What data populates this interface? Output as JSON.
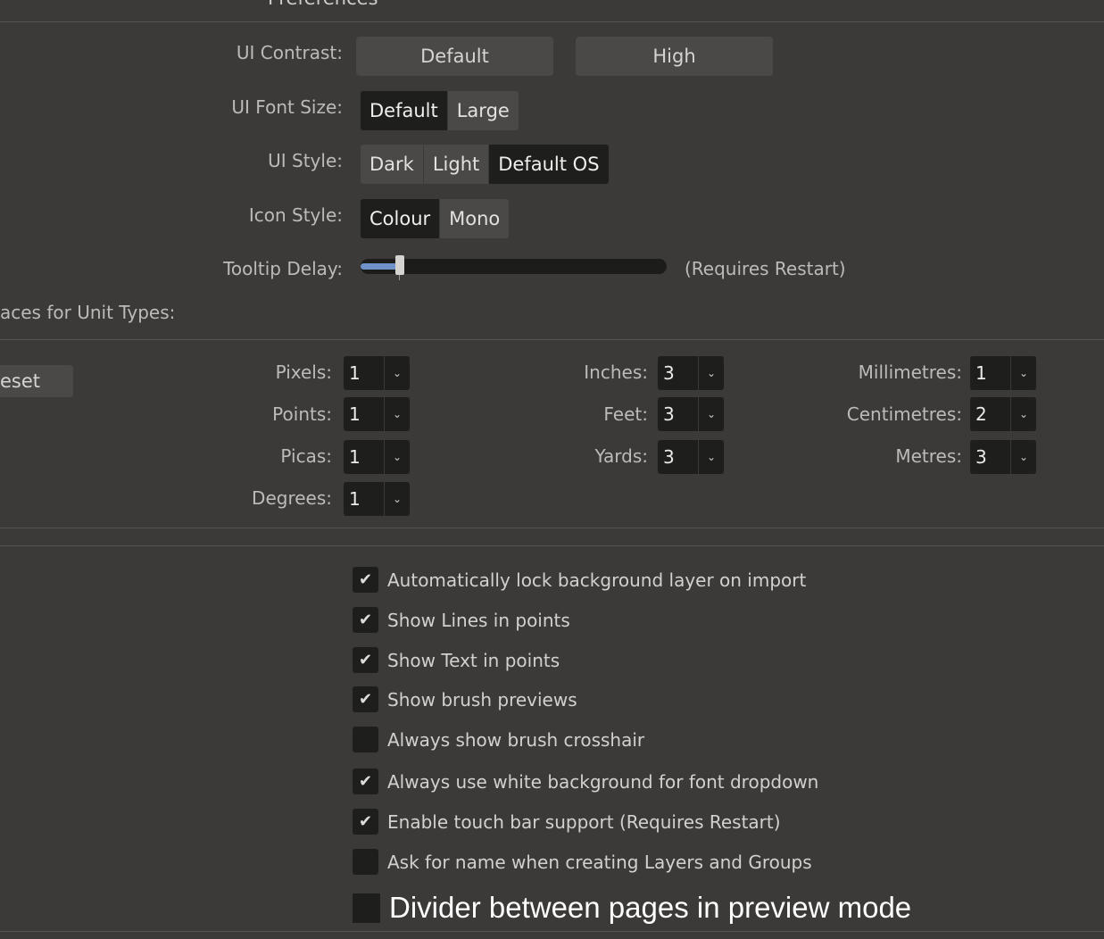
{
  "window": {
    "title": "Preferences"
  },
  "ui_contrast": {
    "label": "UI Contrast:",
    "buttons": [
      "Default",
      "High"
    ]
  },
  "ui_font_size": {
    "label": "UI Font Size:",
    "options": [
      "Default",
      "Large"
    ],
    "selected": "Default"
  },
  "ui_style": {
    "label": "UI Style:",
    "options": [
      "Dark",
      "Light",
      "Default OS"
    ],
    "selected": "Default OS"
  },
  "icon_style": {
    "label": "Icon Style:",
    "options": [
      "Colour",
      "Mono"
    ],
    "selected": "Colour"
  },
  "tooltip_delay": {
    "label": "Tooltip Delay:",
    "note": "(Requires Restart)",
    "level_fraction": 0.12
  },
  "decimal_places": {
    "label": "aces for Unit Types:",
    "reset_label": "eset",
    "col1": [
      {
        "label": "Pixels:",
        "value": "1"
      },
      {
        "label": "Points:",
        "value": "1"
      },
      {
        "label": "Picas:",
        "value": "1"
      },
      {
        "label": "Degrees:",
        "value": "1"
      }
    ],
    "col2": [
      {
        "label": "Inches:",
        "value": "3"
      },
      {
        "label": "Feet:",
        "value": "3"
      },
      {
        "label": "Yards:",
        "value": "3"
      }
    ],
    "col3": [
      {
        "label": "Millimetres:",
        "value": "1"
      },
      {
        "label": "Centimetres:",
        "value": "2"
      },
      {
        "label": "Metres:",
        "value": "3"
      }
    ]
  },
  "checkboxes": [
    {
      "label": "Automatically lock background layer on import",
      "checked": true
    },
    {
      "label": "Show Lines in points",
      "checked": true
    },
    {
      "label": "Show Text in points",
      "checked": true
    },
    {
      "label": "Show brush previews",
      "checked": true
    },
    {
      "label": "Always show brush crosshair",
      "checked": false
    },
    {
      "label": "Always use white background for font dropdown",
      "checked": true
    },
    {
      "label": "Enable touch bar support (Requires Restart)",
      "checked": true
    },
    {
      "label": "Ask for name when creating Layers and Groups",
      "checked": false
    },
    {
      "label": "Divider between pages in preview mode",
      "checked": false
    }
  ],
  "icons": {
    "check": "checkmark-icon",
    "dropdown": "chevron-down-icon"
  },
  "colors": {
    "background": "#3b3a38",
    "selected": "#1e1e1d",
    "accent": "#6f93c9"
  }
}
